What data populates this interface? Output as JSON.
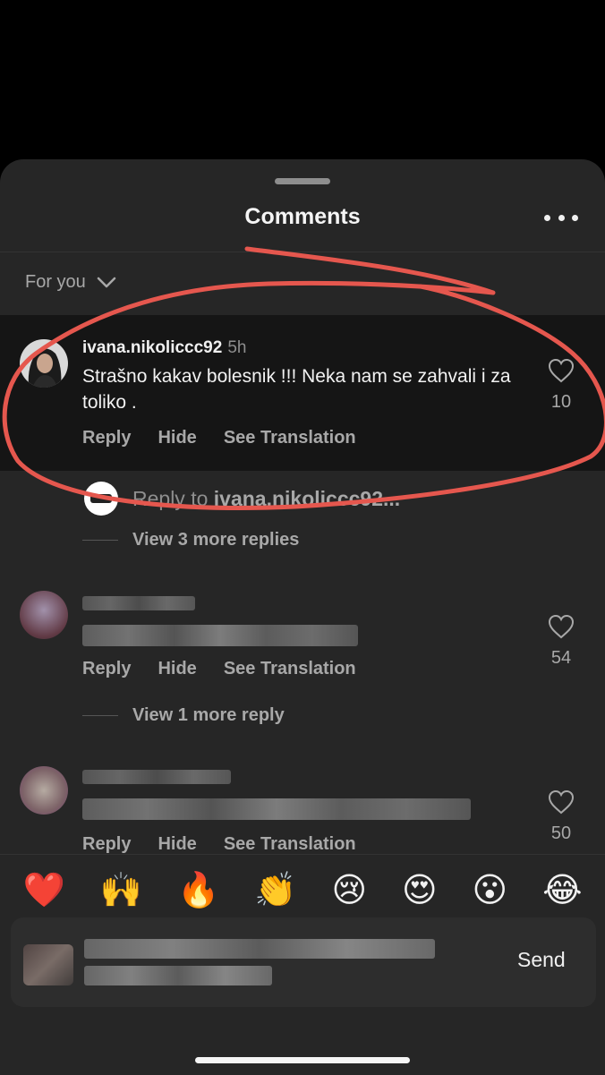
{
  "header": {
    "title": "Comments"
  },
  "sort": {
    "label": "For you"
  },
  "comments": [
    {
      "username": "ivana.nikoliccc92",
      "time": "5h",
      "text": "Strašno kakav bolesnik !!! Neka nam se zahvali i za toliko .",
      "actions": [
        "Reply",
        "Hide",
        "See Translation"
      ],
      "likes": "10"
    },
    {
      "actions": [
        "Reply",
        "Hide",
        "See Translation"
      ],
      "likes": "54"
    },
    {
      "actions": [
        "Reply",
        "Hide",
        "See Translation"
      ],
      "likes": "50"
    }
  ],
  "reply_prompt": {
    "prefix": "Reply to ",
    "username": "ivana.nikoliccc92..."
  },
  "view_more": [
    "View 3 more replies",
    "View 1 more reply"
  ],
  "emojis": [
    "❤️",
    "🙌",
    "🔥",
    "👏",
    "😢",
    "😍",
    "😮",
    "😂"
  ],
  "composer": {
    "send_label": "Send"
  },
  "colors": {
    "annotation": "#e5574e",
    "sheet_bg": "#262626",
    "highlight_bg": "#151515"
  }
}
